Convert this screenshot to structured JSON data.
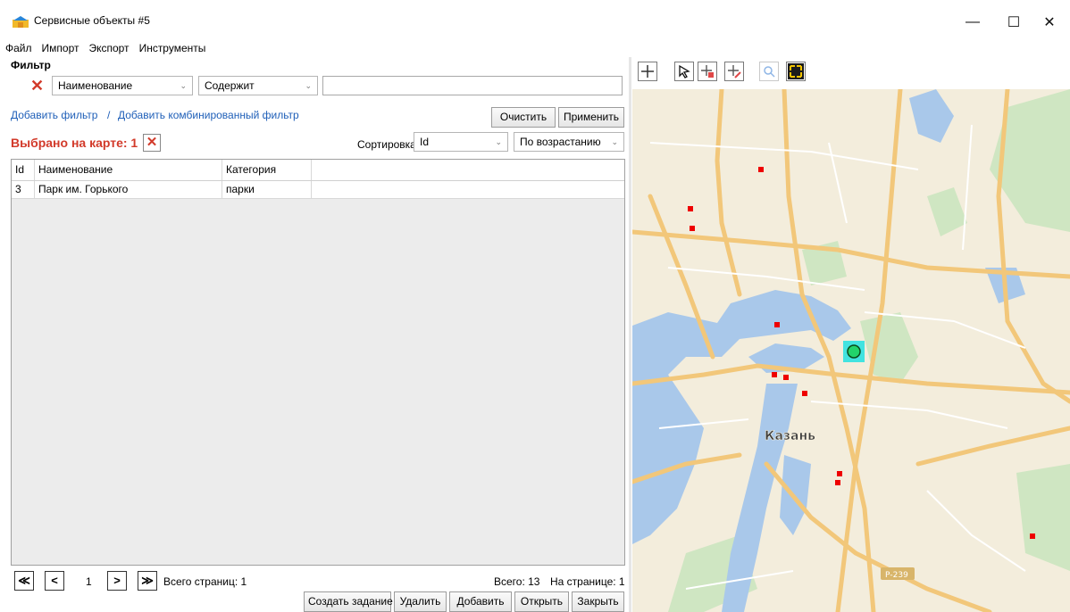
{
  "window": {
    "title": "Сервисные объекты #5",
    "minimize_glyph": "—",
    "maximize_glyph": "☐",
    "close_glyph": "✕"
  },
  "menu": [
    "Файл",
    "Импорт",
    "Экспорт",
    "Инструменты"
  ],
  "filter": {
    "caption": "Фильтр",
    "field": "Наименование",
    "operator": "Содержит",
    "value": "",
    "add_filter_link": "Добавить фильтр",
    "separator": "/",
    "add_combined_link": "Добавить комбинированный фильтр",
    "clear_button": "Очистить",
    "apply_button": "Применить"
  },
  "selection": {
    "label": "Выбрано на карте: 1",
    "clear_glyph": "✕"
  },
  "sort": {
    "label": "Сортировка",
    "field": "Id",
    "direction": "По возрастанию"
  },
  "grid": {
    "columns": [
      "Id",
      "Наименование",
      "Категория"
    ],
    "rows": [
      {
        "id": "3",
        "name": "Парк им. Горького",
        "category": "парки"
      }
    ]
  },
  "pager": {
    "first": "≪",
    "prev": "<",
    "page": "1",
    "next": ">",
    "last": "≫",
    "total_pages": "Всего страниц: 1",
    "total": "Всего: 13",
    "per_page": "На странице: 1"
  },
  "actions": [
    "Создать задание",
    "Удалить",
    "Добавить",
    "Открыть",
    "Закрыть"
  ],
  "map": {
    "city_label": "Казань",
    "road_label": "Р-239",
    "tools": [
      "crosshair-icon",
      "select-arrow-icon",
      "add-point-icon",
      "add-line-icon",
      "zoom-icon",
      "zoom-extent-icon"
    ]
  },
  "colors": {
    "accent_red": "#d23a2a",
    "link_blue": "#1f5fb8",
    "marker_red": "#ee0000",
    "selected_marker": "#22d36a"
  }
}
